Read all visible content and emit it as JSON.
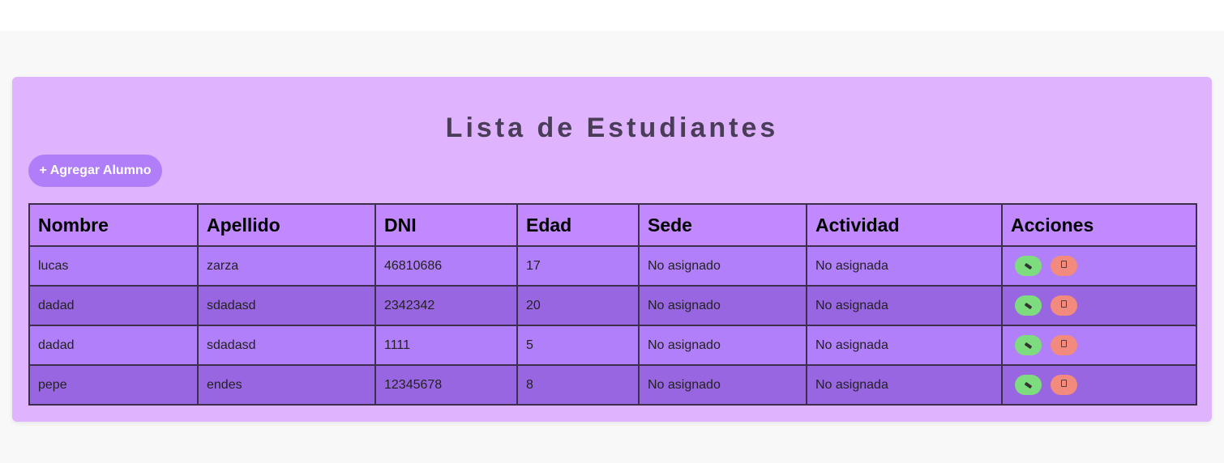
{
  "page": {
    "title": "Lista de Estudiantes",
    "add_button_label": "+ Agregar Alumno"
  },
  "table": {
    "headers": [
      "Nombre",
      "Apellido",
      "DNI",
      "Edad",
      "Sede",
      "Actividad",
      "Acciones"
    ],
    "rows": [
      {
        "nombre": "lucas",
        "apellido": "zarza",
        "dni": "46810686",
        "edad": "17",
        "sede": "No asignado",
        "actividad": "No asignada"
      },
      {
        "nombre": "dadad",
        "apellido": "sdadasd",
        "dni": "2342342",
        "edad": "20",
        "sede": "No asignado",
        "actividad": "No asignada"
      },
      {
        "nombre": "dadad",
        "apellido": "sdadasd",
        "dni": "1111",
        "edad": "5",
        "sede": "No asignado",
        "actividad": "No asignada"
      },
      {
        "nombre": "pepe",
        "apellido": "endes",
        "dni": "12345678",
        "edad": "8",
        "sede": "No asignado",
        "actividad": "No asignada"
      }
    ],
    "row_actions": [
      {
        "name": "edit",
        "icon": "pencil-icon"
      },
      {
        "name": "delete",
        "icon": "trash-icon"
      }
    ]
  },
  "colors": {
    "card_background": "#dfb3fd",
    "header_background": "#c189fd",
    "row_light": "#b17ffa",
    "row_dark": "#9966e1",
    "add_button": "#b07ef8",
    "edit_button": "#7ddc7d",
    "delete_button": "#f28a7e"
  }
}
